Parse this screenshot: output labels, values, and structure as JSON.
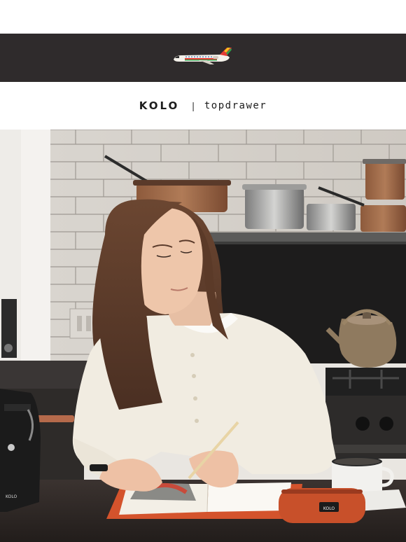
{
  "header": {
    "banner_icon": "airplane-icon",
    "colors": {
      "banner_bg": "#2f2b2c",
      "page_bg": "#ffffff"
    }
  },
  "brand": {
    "primary": "KOLO",
    "separator": "|",
    "secondary": "topdrawer"
  },
  "hero": {
    "pencil_case_label": "KOLO",
    "bag_label": "KOLO"
  }
}
